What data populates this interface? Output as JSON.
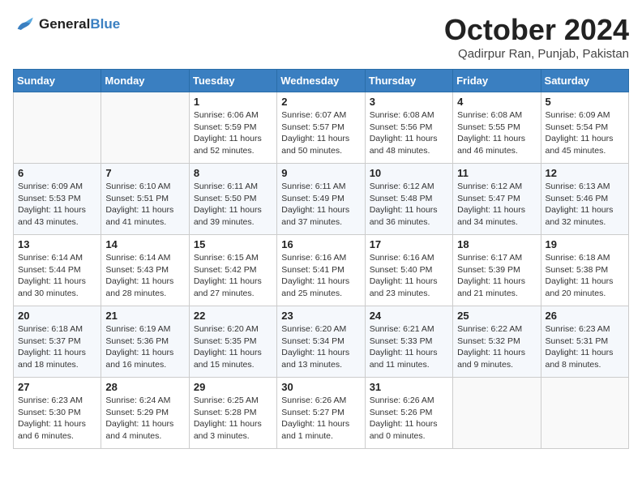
{
  "logo": {
    "general": "General",
    "blue": "Blue"
  },
  "title": "October 2024",
  "subtitle": "Qadirpur Ran, Punjab, Pakistan",
  "days_of_week": [
    "Sunday",
    "Monday",
    "Tuesday",
    "Wednesday",
    "Thursday",
    "Friday",
    "Saturday"
  ],
  "weeks": [
    [
      {
        "day": "",
        "sunrise": "",
        "sunset": "",
        "daylight": ""
      },
      {
        "day": "",
        "sunrise": "",
        "sunset": "",
        "daylight": ""
      },
      {
        "day": "1",
        "sunrise": "Sunrise: 6:06 AM",
        "sunset": "Sunset: 5:59 PM",
        "daylight": "Daylight: 11 hours and 52 minutes."
      },
      {
        "day": "2",
        "sunrise": "Sunrise: 6:07 AM",
        "sunset": "Sunset: 5:57 PM",
        "daylight": "Daylight: 11 hours and 50 minutes."
      },
      {
        "day": "3",
        "sunrise": "Sunrise: 6:08 AM",
        "sunset": "Sunset: 5:56 PM",
        "daylight": "Daylight: 11 hours and 48 minutes."
      },
      {
        "day": "4",
        "sunrise": "Sunrise: 6:08 AM",
        "sunset": "Sunset: 5:55 PM",
        "daylight": "Daylight: 11 hours and 46 minutes."
      },
      {
        "day": "5",
        "sunrise": "Sunrise: 6:09 AM",
        "sunset": "Sunset: 5:54 PM",
        "daylight": "Daylight: 11 hours and 45 minutes."
      }
    ],
    [
      {
        "day": "6",
        "sunrise": "Sunrise: 6:09 AM",
        "sunset": "Sunset: 5:53 PM",
        "daylight": "Daylight: 11 hours and 43 minutes."
      },
      {
        "day": "7",
        "sunrise": "Sunrise: 6:10 AM",
        "sunset": "Sunset: 5:51 PM",
        "daylight": "Daylight: 11 hours and 41 minutes."
      },
      {
        "day": "8",
        "sunrise": "Sunrise: 6:11 AM",
        "sunset": "Sunset: 5:50 PM",
        "daylight": "Daylight: 11 hours and 39 minutes."
      },
      {
        "day": "9",
        "sunrise": "Sunrise: 6:11 AM",
        "sunset": "Sunset: 5:49 PM",
        "daylight": "Daylight: 11 hours and 37 minutes."
      },
      {
        "day": "10",
        "sunrise": "Sunrise: 6:12 AM",
        "sunset": "Sunset: 5:48 PM",
        "daylight": "Daylight: 11 hours and 36 minutes."
      },
      {
        "day": "11",
        "sunrise": "Sunrise: 6:12 AM",
        "sunset": "Sunset: 5:47 PM",
        "daylight": "Daylight: 11 hours and 34 minutes."
      },
      {
        "day": "12",
        "sunrise": "Sunrise: 6:13 AM",
        "sunset": "Sunset: 5:46 PM",
        "daylight": "Daylight: 11 hours and 32 minutes."
      }
    ],
    [
      {
        "day": "13",
        "sunrise": "Sunrise: 6:14 AM",
        "sunset": "Sunset: 5:44 PM",
        "daylight": "Daylight: 11 hours and 30 minutes."
      },
      {
        "day": "14",
        "sunrise": "Sunrise: 6:14 AM",
        "sunset": "Sunset: 5:43 PM",
        "daylight": "Daylight: 11 hours and 28 minutes."
      },
      {
        "day": "15",
        "sunrise": "Sunrise: 6:15 AM",
        "sunset": "Sunset: 5:42 PM",
        "daylight": "Daylight: 11 hours and 27 minutes."
      },
      {
        "day": "16",
        "sunrise": "Sunrise: 6:16 AM",
        "sunset": "Sunset: 5:41 PM",
        "daylight": "Daylight: 11 hours and 25 minutes."
      },
      {
        "day": "17",
        "sunrise": "Sunrise: 6:16 AM",
        "sunset": "Sunset: 5:40 PM",
        "daylight": "Daylight: 11 hours and 23 minutes."
      },
      {
        "day": "18",
        "sunrise": "Sunrise: 6:17 AM",
        "sunset": "Sunset: 5:39 PM",
        "daylight": "Daylight: 11 hours and 21 minutes."
      },
      {
        "day": "19",
        "sunrise": "Sunrise: 6:18 AM",
        "sunset": "Sunset: 5:38 PM",
        "daylight": "Daylight: 11 hours and 20 minutes."
      }
    ],
    [
      {
        "day": "20",
        "sunrise": "Sunrise: 6:18 AM",
        "sunset": "Sunset: 5:37 PM",
        "daylight": "Daylight: 11 hours and 18 minutes."
      },
      {
        "day": "21",
        "sunrise": "Sunrise: 6:19 AM",
        "sunset": "Sunset: 5:36 PM",
        "daylight": "Daylight: 11 hours and 16 minutes."
      },
      {
        "day": "22",
        "sunrise": "Sunrise: 6:20 AM",
        "sunset": "Sunset: 5:35 PM",
        "daylight": "Daylight: 11 hours and 15 minutes."
      },
      {
        "day": "23",
        "sunrise": "Sunrise: 6:20 AM",
        "sunset": "Sunset: 5:34 PM",
        "daylight": "Daylight: 11 hours and 13 minutes."
      },
      {
        "day": "24",
        "sunrise": "Sunrise: 6:21 AM",
        "sunset": "Sunset: 5:33 PM",
        "daylight": "Daylight: 11 hours and 11 minutes."
      },
      {
        "day": "25",
        "sunrise": "Sunrise: 6:22 AM",
        "sunset": "Sunset: 5:32 PM",
        "daylight": "Daylight: 11 hours and 9 minutes."
      },
      {
        "day": "26",
        "sunrise": "Sunrise: 6:23 AM",
        "sunset": "Sunset: 5:31 PM",
        "daylight": "Daylight: 11 hours and 8 minutes."
      }
    ],
    [
      {
        "day": "27",
        "sunrise": "Sunrise: 6:23 AM",
        "sunset": "Sunset: 5:30 PM",
        "daylight": "Daylight: 11 hours and 6 minutes."
      },
      {
        "day": "28",
        "sunrise": "Sunrise: 6:24 AM",
        "sunset": "Sunset: 5:29 PM",
        "daylight": "Daylight: 11 hours and 4 minutes."
      },
      {
        "day": "29",
        "sunrise": "Sunrise: 6:25 AM",
        "sunset": "Sunset: 5:28 PM",
        "daylight": "Daylight: 11 hours and 3 minutes."
      },
      {
        "day": "30",
        "sunrise": "Sunrise: 6:26 AM",
        "sunset": "Sunset: 5:27 PM",
        "daylight": "Daylight: 11 hours and 1 minute."
      },
      {
        "day": "31",
        "sunrise": "Sunrise: 6:26 AM",
        "sunset": "Sunset: 5:26 PM",
        "daylight": "Daylight: 11 hours and 0 minutes."
      },
      {
        "day": "",
        "sunrise": "",
        "sunset": "",
        "daylight": ""
      },
      {
        "day": "",
        "sunrise": "",
        "sunset": "",
        "daylight": ""
      }
    ]
  ]
}
